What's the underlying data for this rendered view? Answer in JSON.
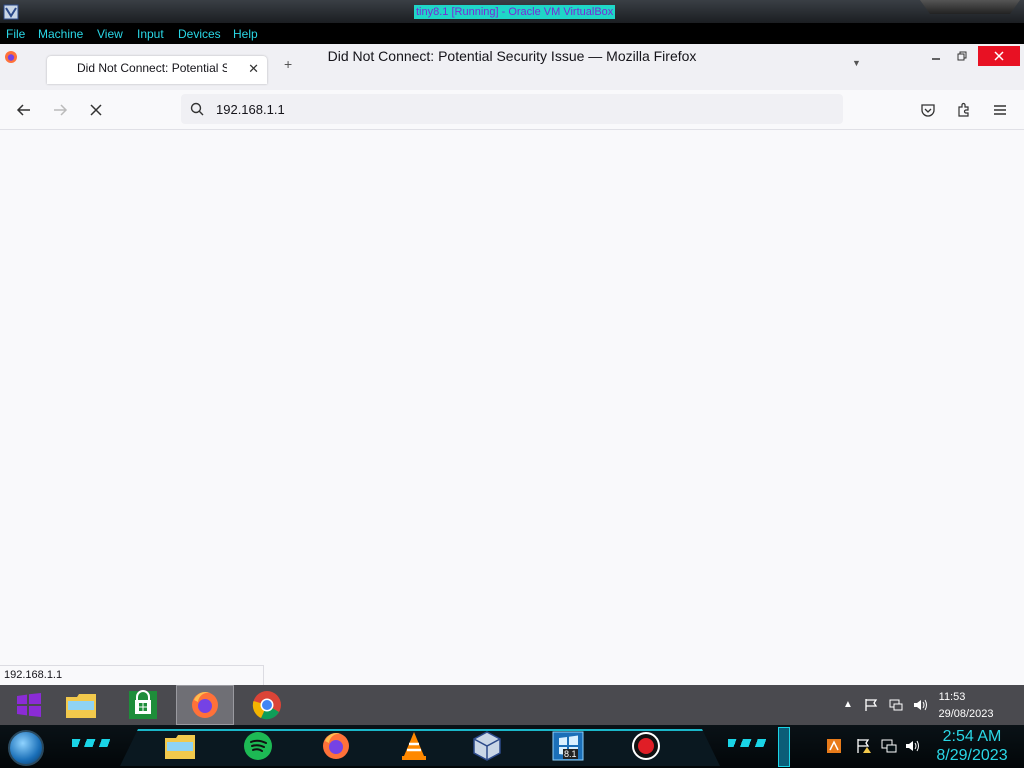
{
  "vbox": {
    "title": "tiny8.1 [Running] - Oracle VM VirtualBox",
    "menu": [
      "File",
      "Machine",
      "View",
      "Input",
      "Devices",
      "Help"
    ]
  },
  "firefox": {
    "window_title": "Did Not Connect: Potential Security Issue — Mozilla Firefox",
    "tab_title": "Did Not Connect: Potential Security Issue",
    "url": "192.168.1.1",
    "status_text": "192.168.1.1"
  },
  "guest_taskbar": {
    "apps": [
      "windows-logo",
      "file-explorer",
      "store",
      "firefox",
      "chrome"
    ],
    "active_app": "firefox",
    "time": "11:53",
    "date": "29/08/2023"
  },
  "host_taskbar": {
    "apps": [
      "file-explorer",
      "spotify",
      "firefox",
      "vlc",
      "virtualbox",
      "windows-8.1-badge",
      "record"
    ],
    "badge_text": "8.1",
    "time": "2:54 AM",
    "date": "8/29/2023"
  },
  "colors": {
    "vbox_title_bg": "#1fd6c7",
    "vbox_menu_text": "#2ad7e6",
    "firefox_bg": "#f9f9fb",
    "host_clock": "#2ad7e6"
  }
}
